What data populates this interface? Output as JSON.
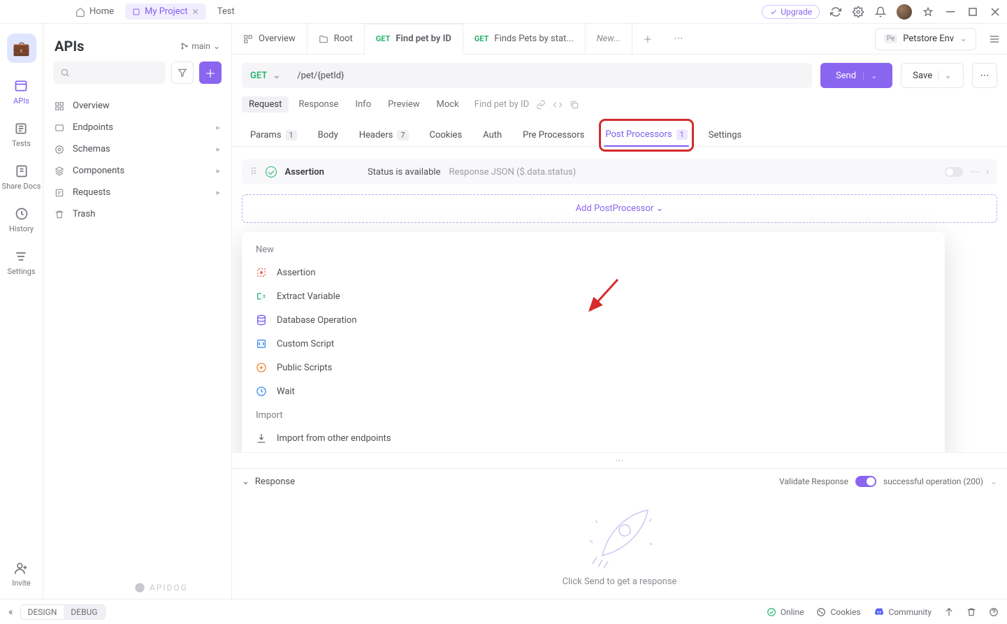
{
  "titlebar": {
    "home": "Home",
    "project": "My Project",
    "test": "Test",
    "upgrade": "Upgrade"
  },
  "rail": {
    "apis": "APIs",
    "tests": "Tests",
    "share": "Share Docs",
    "history": "History",
    "settings": "Settings",
    "invite": "Invite"
  },
  "sidebar": {
    "title": "APIs",
    "branch": "main",
    "items": {
      "overview": "Overview",
      "endpoints": "Endpoints",
      "schemas": "Schemas",
      "components": "Components",
      "requests": "Requests",
      "trash": "Trash"
    }
  },
  "maintabs": {
    "overview": "Overview",
    "root": "Root",
    "t1_method": "GET",
    "t1": "Find pet by ID",
    "t2_method": "GET",
    "t2": "Finds Pets by stat...",
    "new": "New...",
    "env_badge": "Pe",
    "env": "Petstore Env"
  },
  "request": {
    "method": "GET",
    "url": "/pet/{petId}",
    "send": "Send",
    "save": "Save"
  },
  "subtoolbar": {
    "request": "Request",
    "response": "Response",
    "info": "Info",
    "preview": "Preview",
    "mock": "Mock",
    "breadcrumb": "Find pet by ID"
  },
  "tabs": {
    "params": "Params",
    "params_count": "1",
    "body": "Body",
    "headers": "Headers",
    "headers_count": "7",
    "cookies": "Cookies",
    "auth": "Auth",
    "pre": "Pre Processors",
    "post": "Post Processors",
    "post_count": "1",
    "settings": "Settings"
  },
  "assertion": {
    "label": "Assertion",
    "desc": "Status is available",
    "path": "Response JSON ($.data.status)"
  },
  "add_button": "Add PostProcessor",
  "dropdown": {
    "new": "New",
    "assertion": "Assertion",
    "extract": "Extract Variable",
    "db": "Database Operation",
    "script": "Custom Script",
    "public": "Public Scripts",
    "wait": "Wait",
    "import_sec": "Import",
    "import_other": "Import from other endpoints"
  },
  "response": {
    "label": "Response",
    "validate": "Validate Response",
    "status": "successful operation (200)",
    "empty": "Click Send to get a response"
  },
  "statusbar": {
    "design": "DESIGN",
    "debug": "DEBUG",
    "online": "Online",
    "cookies": "Cookies",
    "community": "Community"
  },
  "footer_brand": "APIDOG"
}
